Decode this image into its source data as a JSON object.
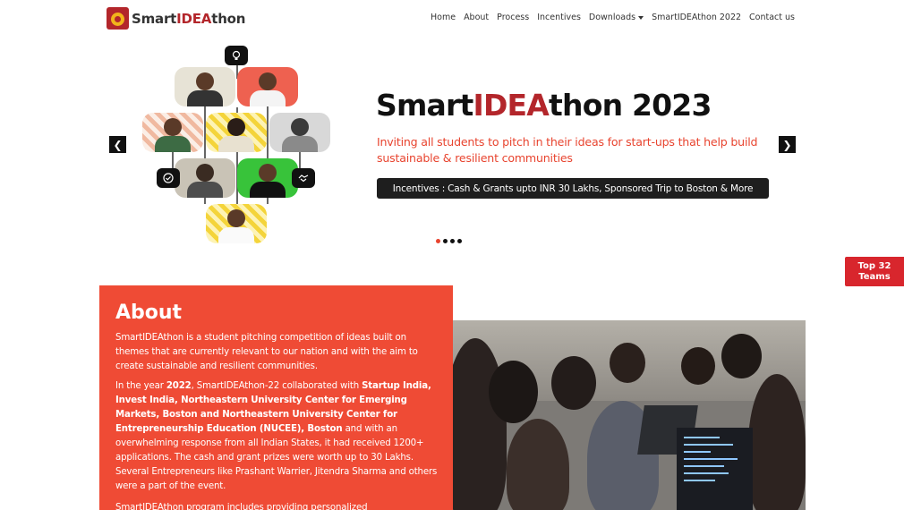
{
  "brand": {
    "prefix": "Smart",
    "highlight": "IDEA",
    "suffix": "thon"
  },
  "nav": {
    "items": [
      "Home",
      "About",
      "Process",
      "Incentives"
    ],
    "downloads": "Downloads",
    "items2": [
      "SmartIDEAthon 2022",
      "Contact us"
    ]
  },
  "hero": {
    "title_prefix": "Smart",
    "title_highlight": "IDEA",
    "title_suffix": "thon 2023",
    "subtitle": "Inviting all students to pitch in their ideas for start-ups that help build sustainable & resilient communities",
    "incentives": "Incentives : Cash & Grants upto INR 30 Lakhs, Sponsored Trip to Boston & More",
    "prev_glyph": "❮",
    "next_glyph": "❯",
    "slide_count": 4,
    "active_slide": 1
  },
  "top_teams": {
    "line1": "Top 32",
    "line2": "Teams"
  },
  "about": {
    "heading": "About",
    "p1": "SmartIDEAthon is a student pitching competition of ideas built on themes that are currently relevant to our nation and with the aim to create sustainable and resilient communities.",
    "p2_a": "In the year ",
    "p2_year": "2022",
    "p2_b": ", SmartIDEAthon-22 collaborated with ",
    "p2_partners": "Startup India, Invest India, Northeastern University Center for Emerging Markets, Boston and Northeastern University Center for Entrepreneurship Education (NUCEE), Boston",
    "p2_c": " and with an overwhelming response from all Indian States, it had received 1200+ applications. The cash and grant prizes were worth up to 30 Lakhs. Several Entrepreneurs like Prashant Warrier, Jitendra Sharma and others were a part of the event.",
    "p3": "SmartIDEAthon program includes providing personalized"
  },
  "colors": {
    "brand_red": "#b3262b",
    "accent_orange": "#ef4b35",
    "subtitle_orange": "#e8442f",
    "pill_bg": "#1e1e1e",
    "top_teams_red": "#d8262d"
  },
  "icons": [
    "lightbulb-icon",
    "check-badge-icon",
    "handshake-icon",
    "chevron-left-icon",
    "chevron-right-icon"
  ]
}
